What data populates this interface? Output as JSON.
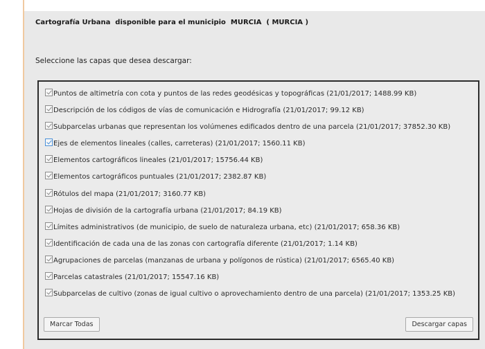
{
  "header": {
    "title": "Cartografía Urbana  disponible para el municipio  MURCIA  ( MURCIA )"
  },
  "instructions": "Seleccione las capas que desea descargar:",
  "layers": [
    {
      "label": "Puntos de altimetría con cota y puntos de las redes geodésicas y topográficas (21/01/2017; 1488.99 KB)",
      "checked": true
    },
    {
      "label": "Descripción de los códigos de vías de comunicación e Hidrografía (21/01/2017; 99.12 KB)",
      "checked": true
    },
    {
      "label": "Subparcelas urbanas que representan los volúmenes edificados dentro de una parcela (21/01/2017; 37852.30 KB)",
      "checked": true
    },
    {
      "label": "Ejes de elementos lineales (calles, carreteras) (21/01/2017; 1560.11 KB)",
      "checked": true
    },
    {
      "label": "Elementos cartográficos lineales (21/01/2017; 15756.44 KB)",
      "checked": true
    },
    {
      "label": "Elementos cartográficos puntuales (21/01/2017; 2382.87 KB)",
      "checked": true
    },
    {
      "label": "Rótulos del mapa (21/01/2017; 3160.77 KB)",
      "checked": true
    },
    {
      "label": "Hojas de división de la cartografía urbana (21/01/2017; 84.19 KB)",
      "checked": true
    },
    {
      "label": "Límites administrativos (de municipio, de suelo de naturaleza urbana, etc) (21/01/2017; 658.36 KB)",
      "checked": true
    },
    {
      "label": "Identificación de cada una de las zonas con cartografía diferente (21/01/2017; 1.14 KB)",
      "checked": true
    },
    {
      "label": "Agrupaciones de parcelas (manzanas de urbana y polígonos de rústica) (21/01/2017; 6565.40 KB)",
      "checked": true
    },
    {
      "label": "Parcelas catastrales (21/01/2017; 15547.16 KB)",
      "checked": true
    },
    {
      "label": "Subparcelas de cultivo (zonas de igual cultivo o aprovechamiento dentro de una parcela) (21/01/2017; 1353.25 KB)",
      "checked": true
    }
  ],
  "buttons": {
    "select_all": "Marcar Todas",
    "download": "Descargar capas"
  },
  "colors": {
    "panel_bg": "#e9e9e9",
    "focus_accent": "#4a90d9"
  }
}
